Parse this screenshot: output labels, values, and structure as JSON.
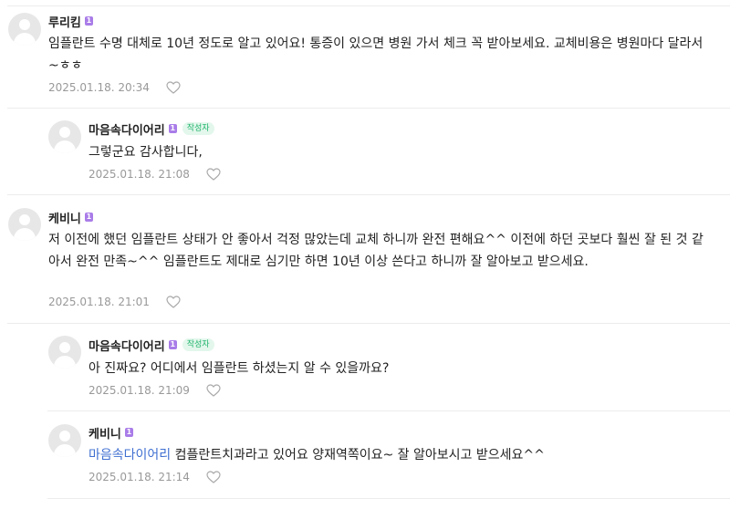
{
  "comments": [
    {
      "nickname": "루리킴",
      "level": "1",
      "text": "임플란트 수명 대체로 10년 정도로 알고 있어요! 통증이 있으면 병원 가서 체크 꼭 받아보세요. 교체비용은 병원마다 달라서~ㅎㅎ",
      "date": "2025.01.18. 20:34"
    },
    {
      "nickname": "마음속다이어리",
      "level": "1",
      "badge": "작성자",
      "text": "그렇군요 감사합니다,",
      "date": "2025.01.18. 21:08"
    },
    {
      "nickname": "케비니",
      "level": "1",
      "text": "저 이전에 했던 임플란트 상태가 안 좋아서 걱정 많았는데 교체 하니까 완전 편해요^^ 이전에 하던 곳보다 훨씬 잘 된 것 같아서 완전 만족~^^ 임플란트도 제대로 심기만 하면 10년 이상 쓴다고 하니까 잘 알아보고 받으세요.",
      "date": "2025.01.18. 21:01"
    },
    {
      "nickname": "마음속다이어리",
      "level": "1",
      "badge": "작성자",
      "text": "아 진짜요? 어디에서 임플란트 하셨는지 알 수 있을까요?",
      "date": "2025.01.18. 21:09"
    },
    {
      "nickname": "케비니",
      "level": "1",
      "mention": "마음속다이어리",
      "text": "컴플란트치과라고 있어요 양재역쪽이요~ 잘 알아보시고 받으세요^^",
      "date": "2025.01.18. 21:14"
    }
  ]
}
